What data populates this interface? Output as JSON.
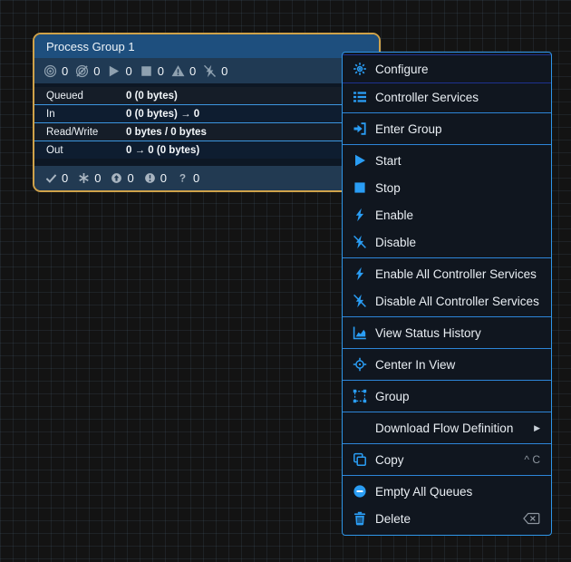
{
  "app": "NiFi flow canvas",
  "process_group": {
    "title": "Process Group 1",
    "status_bar": [
      {
        "icon": "bullseye-icon",
        "count": "0"
      },
      {
        "icon": "bullseye-slash-icon",
        "count": "0"
      },
      {
        "icon": "play-icon",
        "count": "0"
      },
      {
        "icon": "stop-icon",
        "count": "0"
      },
      {
        "icon": "warning-triangle-icon",
        "count": "0"
      },
      {
        "icon": "bolt-slash-icon",
        "count": "0"
      }
    ],
    "stats": [
      {
        "label": "Queued",
        "value": "0 (0 bytes)"
      },
      {
        "label": "In",
        "value": "0 (0 bytes) → 0"
      },
      {
        "label": "Read/Write",
        "value": "0 bytes / 0 bytes"
      },
      {
        "label": "Out",
        "value": "0 → 0 (0 bytes)"
      }
    ],
    "footer": [
      {
        "icon": "check-icon",
        "count": "0"
      },
      {
        "icon": "asterisk-icon",
        "count": "0"
      },
      {
        "icon": "arrow-up-circle-icon",
        "count": "0"
      },
      {
        "icon": "exclamation-circle-icon",
        "count": "0"
      },
      {
        "icon": "question-icon",
        "count": "0"
      }
    ],
    "colors": {
      "selected_border": "#cfa24a",
      "header_bg": "#1e4f7e",
      "status_row_bg": "#203a54",
      "footer_bg": "#223a52",
      "stat_divider": "#3c96e0"
    }
  },
  "context_menu": {
    "items": [
      {
        "type": "item",
        "icon": "gear-icon",
        "label": "Configure",
        "focused": true
      },
      {
        "type": "item",
        "icon": "list-icon",
        "label": "Controller Services"
      },
      {
        "type": "divider"
      },
      {
        "type": "item",
        "icon": "enter-group-icon",
        "label": "Enter Group"
      },
      {
        "type": "divider"
      },
      {
        "type": "item",
        "icon": "play-icon",
        "label": "Start"
      },
      {
        "type": "item",
        "icon": "stop-icon",
        "label": "Stop"
      },
      {
        "type": "item",
        "icon": "bolt-icon",
        "label": "Enable"
      },
      {
        "type": "item",
        "icon": "bolt-slash-icon",
        "label": "Disable"
      },
      {
        "type": "divider"
      },
      {
        "type": "item",
        "icon": "bolt-icon",
        "label": "Enable All Controller Services"
      },
      {
        "type": "item",
        "icon": "bolt-slash-icon",
        "label": "Disable All Controller Services"
      },
      {
        "type": "divider"
      },
      {
        "type": "item",
        "icon": "chart-area-icon",
        "label": "View Status History"
      },
      {
        "type": "divider"
      },
      {
        "type": "item",
        "icon": "crosshairs-icon",
        "label": "Center In View"
      },
      {
        "type": "divider"
      },
      {
        "type": "item",
        "icon": "object-group-icon",
        "label": "Group"
      },
      {
        "type": "divider"
      },
      {
        "type": "item",
        "icon": null,
        "label": "Download Flow Definition",
        "submenu": "▶"
      },
      {
        "type": "divider"
      },
      {
        "type": "item",
        "icon": "copy-icon",
        "label": "Copy",
        "shortcut": "^ C"
      },
      {
        "type": "divider"
      },
      {
        "type": "item",
        "icon": "minus-circle-icon",
        "label": "Empty All Queues"
      },
      {
        "type": "item",
        "icon": "trash-icon",
        "label": "Delete",
        "shortcut_icon": "backspace-icon"
      }
    ],
    "colors": {
      "bg": "#10161f",
      "border": "#2f96e8",
      "divider": "#2d85d8",
      "focus_outline": "#1e3190",
      "icon_accent": "#2a9df4",
      "text": "#e9eef3",
      "shortcut_text": "#8d959e"
    }
  }
}
